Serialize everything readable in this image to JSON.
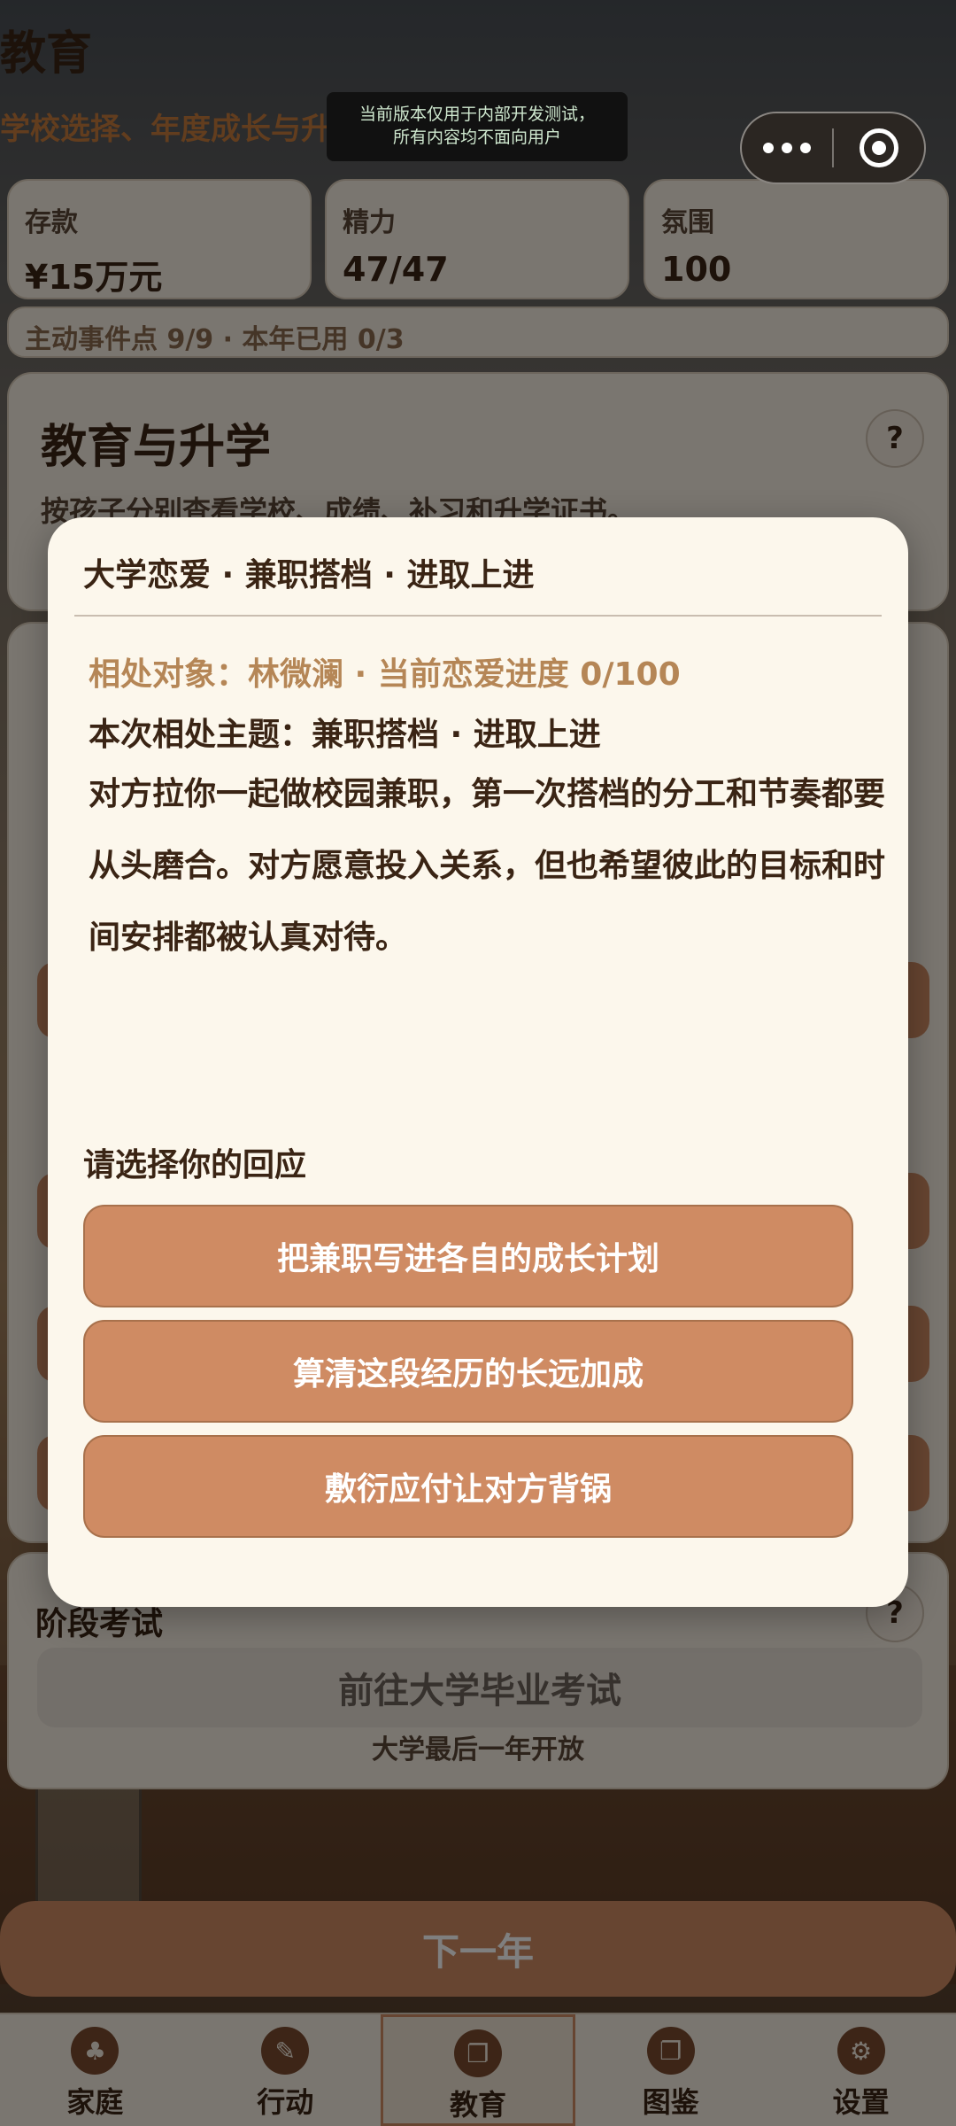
{
  "header": {
    "title": "教育",
    "subtitle": "学校选择、年度成长与升学"
  },
  "dev_banner": {
    "line1": "当前版本仅用于内部开发测试，",
    "line2": "所有内容均不面向用户"
  },
  "capsule": {
    "more_icon": "more-dots-icon",
    "close_icon": "target-icon"
  },
  "stats": [
    {
      "label": "存款",
      "value": "¥15万元"
    },
    {
      "label": "精力",
      "value": "47/47"
    },
    {
      "label": "氛围",
      "value": "100"
    }
  ],
  "points_text": "主动事件点 9/9 · 本年已用 0/3",
  "education_card": {
    "title": "教育与升学",
    "desc": "按孩子分别查看学校、成绩、补习和升学证书。",
    "help": "?"
  },
  "exam_card": {
    "title": "阶段考试",
    "help": "?",
    "button": "前往大学毕业考试",
    "note": "大学最后一年开放"
  },
  "next_year_label": "下一年",
  "tabs": [
    {
      "label": "家庭",
      "icon": "family-icon",
      "glyph": "♣",
      "active": false
    },
    {
      "label": "行动",
      "icon": "action-icon",
      "glyph": "✎",
      "active": false
    },
    {
      "label": "教育",
      "icon": "book-icon",
      "glyph": "❐",
      "active": true
    },
    {
      "label": "图鉴",
      "icon": "album-icon",
      "glyph": "❐",
      "active": false
    },
    {
      "label": "设置",
      "icon": "gear-icon",
      "glyph": "⚙",
      "active": false
    }
  ],
  "modal": {
    "title": "大学恋爱 · 兼职搭档 · 进取上进",
    "partner": "相处对象：林微澜 · 当前恋爱进度 0/100",
    "theme": "本次相处主题：兼职搭档 · 进取上进",
    "story": "对方拉你一起做校园兼职，第一次搭档的分工和节奏都要从头磨合。对方愿意投入关系，但也希望彼此的目标和时间安排都被认真对待。",
    "prompt": "请选择你的回应",
    "choices": [
      "把兼职写进各自的成长计划",
      "算清这段经历的长远加成",
      "敷衍应付让对方背锅"
    ]
  },
  "colors": {
    "accent": "#cf8b63",
    "card_bg": "#f5ece0",
    "modal_bg": "#fcf7ec",
    "partner_text": "#b58656"
  }
}
